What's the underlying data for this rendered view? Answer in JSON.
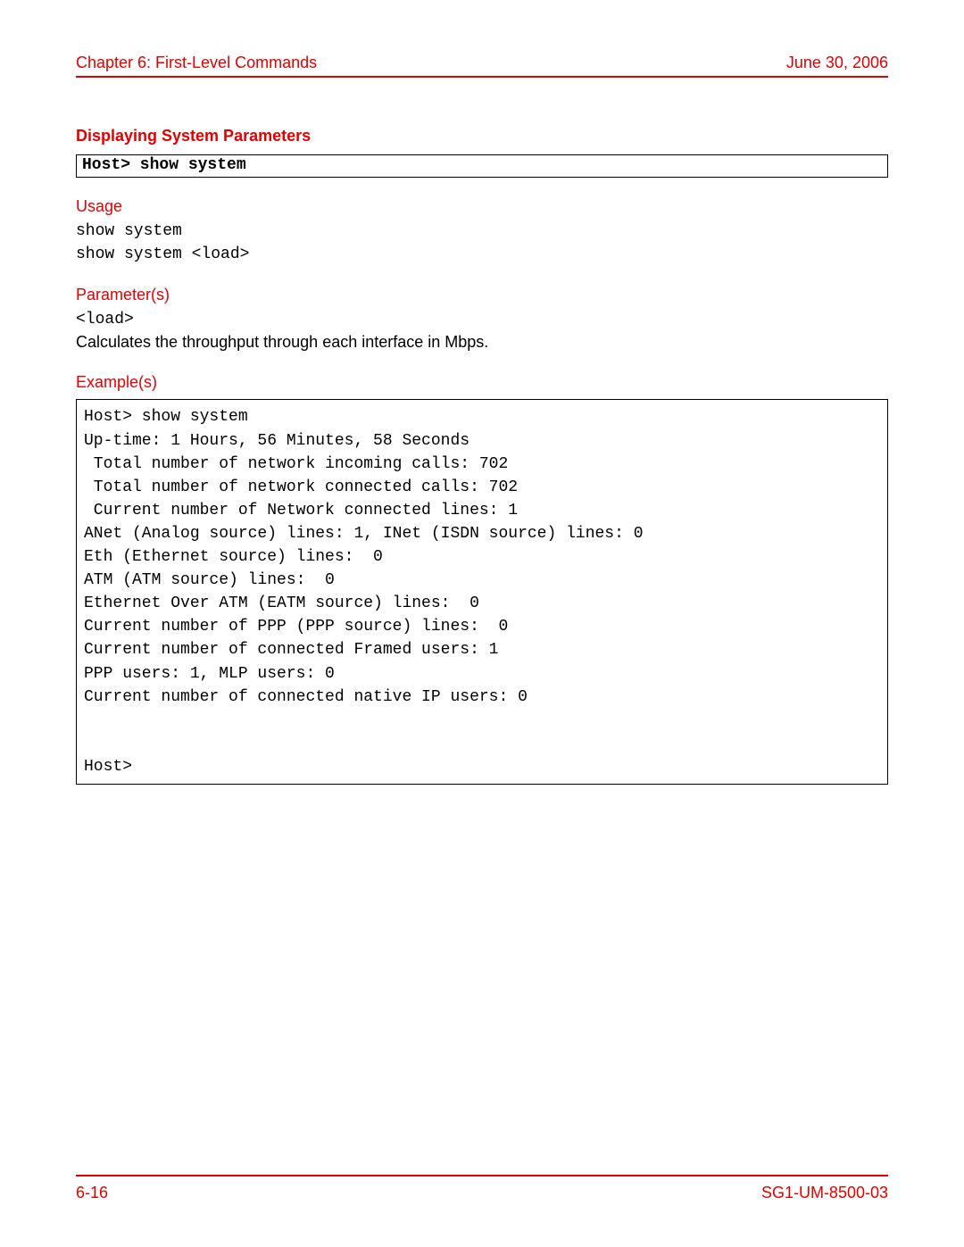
{
  "header": {
    "chapter": "Chapter 6: First-Level Commands",
    "date": "June 30, 2006"
  },
  "section": {
    "title": "Displaying System Parameters",
    "command": "Host> show system"
  },
  "usage": {
    "heading": "Usage",
    "lines": "show system\nshow system <load>"
  },
  "parameters": {
    "heading": "Parameter(s)",
    "name": "<load>",
    "description": "Calculates the throughput through each interface in Mbps."
  },
  "examples": {
    "heading": "Example(s)",
    "output": "Host> show system\nUp-time: 1 Hours, 56 Minutes, 58 Seconds\n Total number of network incoming calls: 702\n Total number of network connected calls: 702\n Current number of Network connected lines: 1\nANet (Analog source) lines: 1, INet (ISDN source) lines: 0\nEth (Ethernet source) lines:  0\nATM (ATM source) lines:  0\nEthernet Over ATM (EATM source) lines:  0\nCurrent number of PPP (PPP source) lines:  0\nCurrent number of connected Framed users: 1\nPPP users: 1, MLP users: 0\nCurrent number of connected native IP users: 0\n\n\nHost>"
  },
  "footer": {
    "page": "6-16",
    "docid": "SG1-UM-8500-03"
  }
}
